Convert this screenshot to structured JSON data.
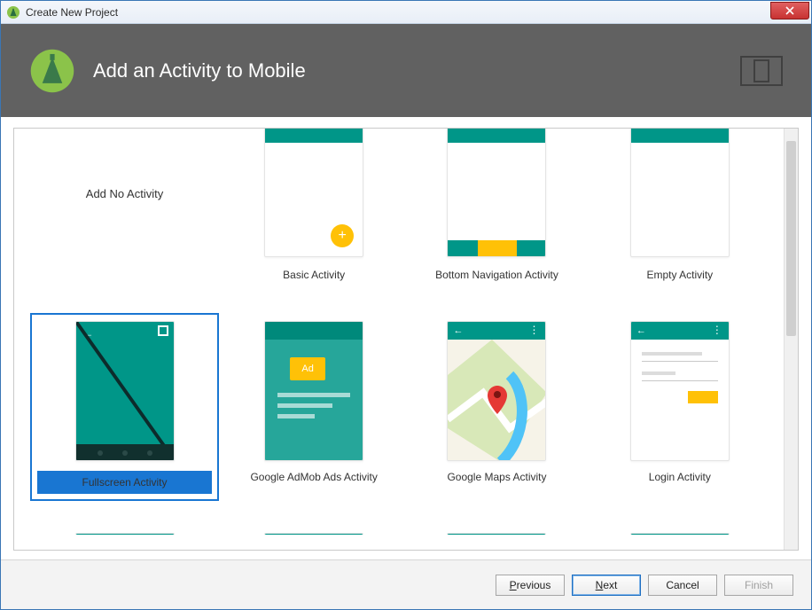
{
  "window": {
    "title": "Create New Project"
  },
  "header": {
    "title": "Add an Activity to Mobile"
  },
  "tiles": {
    "no_activity": "Add No Activity",
    "basic": "Basic Activity",
    "bottom_nav": "Bottom Navigation Activity",
    "empty": "Empty Activity",
    "fullscreen": "Fullscreen Activity",
    "admob": "Google AdMob Ads Activity",
    "maps": "Google Maps Activity",
    "login": "Login Activity"
  },
  "selected": "fullscreen",
  "buttons": {
    "previous": "Previous",
    "next": "Next",
    "cancel": "Cancel",
    "finish": "Finish"
  },
  "ad_label": "Ad"
}
